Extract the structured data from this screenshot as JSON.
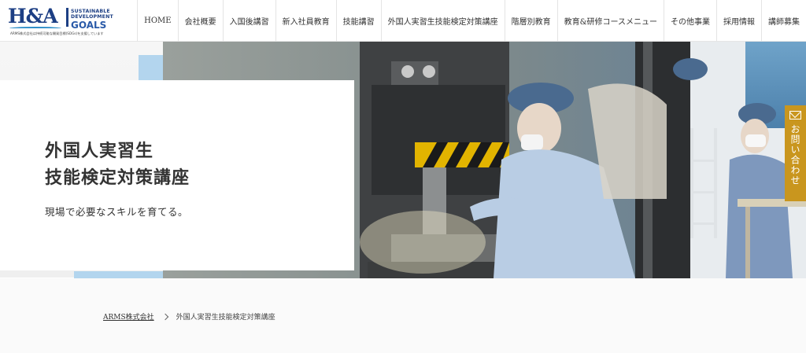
{
  "header": {
    "logo": {
      "mark": "H&A",
      "sdg_lines": [
        "SUSTAINABLE",
        "DEVELOPMENT"
      ],
      "sdg_goals": "GOALS",
      "caption": "ARMS株式会社は持続可能な開発目標(SDGs)を支援しています"
    },
    "nav": [
      {
        "name": "nav-home",
        "label": "HOME"
      },
      {
        "name": "nav-company",
        "label": "会社概要"
      },
      {
        "name": "nav-post-entry",
        "label": "入国後講習"
      },
      {
        "name": "nav-new-employee",
        "label": "新入社員教育"
      },
      {
        "name": "nav-skills",
        "label": "技能講習"
      },
      {
        "name": "nav-trainee-exam",
        "label": "外国人実習生技能検定対策講座"
      },
      {
        "name": "nav-level-education",
        "label": "階層別教育"
      },
      {
        "name": "nav-course-menu",
        "label": "教育&研修コースメニュー"
      },
      {
        "name": "nav-other",
        "label": "その他事業"
      },
      {
        "name": "nav-recruit",
        "label": "採用情報"
      },
      {
        "name": "nav-instructor",
        "label": "講師募集"
      }
    ]
  },
  "hero": {
    "title_line1": "外国人実習生",
    "title_line2": "技能検定対策講座",
    "subtitle": "現場で必要なスキルを育てる。"
  },
  "contact": {
    "icon": "mail-icon",
    "label": "お問い合わせ",
    "color": "#c9961e"
  },
  "breadcrumb": {
    "home": "ARMS株式会社",
    "current": "外国人実習生技能検定対策講座"
  },
  "colors": {
    "brand_navy": "#1d3f84",
    "accent_blue": "#b3d5ee",
    "contact_gold": "#c9961e"
  }
}
